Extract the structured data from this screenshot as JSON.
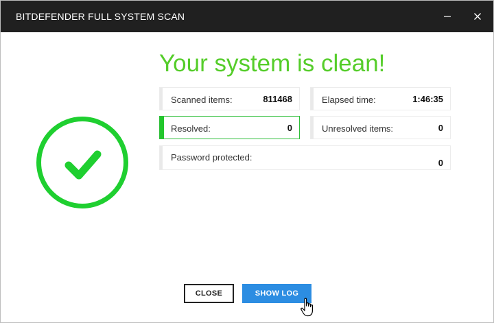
{
  "window": {
    "title": "BITDEFENDER FULL SYSTEM SCAN",
    "minimize_icon": "minimize-icon",
    "close_icon": "close-icon"
  },
  "status": {
    "headline": "Your system is clean!",
    "icon": "checkmark-circle-icon",
    "accent_color": "#1fcf30"
  },
  "stats": {
    "scanned": {
      "label": "Scanned items:",
      "value": "811468"
    },
    "elapsed": {
      "label": "Elapsed time:",
      "value": "1:46:35"
    },
    "resolved": {
      "label": "Resolved:",
      "value": "0"
    },
    "unresolved": {
      "label": "Unresolved items:",
      "value": "0"
    },
    "password": {
      "label": "Password protected:",
      "value": "0"
    }
  },
  "actions": {
    "close_label": "CLOSE",
    "show_log_label": "SHOW LOG",
    "primary_color": "#2c8de2"
  }
}
